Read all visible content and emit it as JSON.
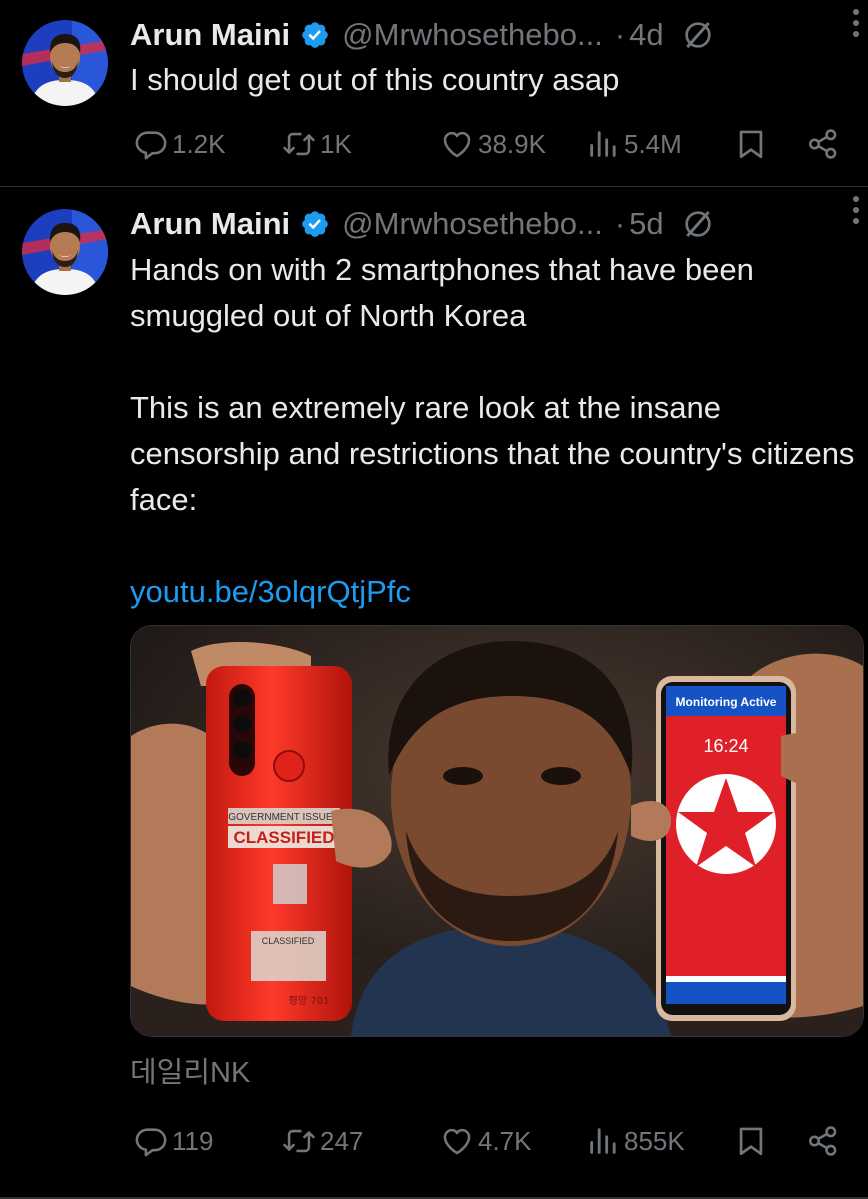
{
  "tweets": [
    {
      "author": "Arun Maini",
      "handle": "@Mrwhosethebo...",
      "separator": "·",
      "time": "4d",
      "paragraphs": [
        "I should get out of this country asap"
      ],
      "stats": {
        "replies": "1.2K",
        "retweets": "1K",
        "likes": "38.9K",
        "views": "5.4M"
      }
    },
    {
      "author": "Arun Maini",
      "handle": "@Mrwhosethebo...",
      "separator": "·",
      "time": "5d",
      "paragraphs": [
        "Hands on with 2 smartphones that have been smuggled out of North Korea",
        "This is an extremely rare look at the insane censorship and restrictions that the country's citizens face:"
      ],
      "link": "youtu.be/3olqrQtjPfc",
      "media": {
        "label_government": "GOVERNMENT ISSUED",
        "label_classified": "CLASSIFIED",
        "label_classified_small": "CLASSIFIED",
        "phone_model": "평양 701",
        "monitor_banner": "Monitoring Active",
        "clock": "16:24"
      },
      "source": "데일리NK",
      "stats": {
        "replies": "119",
        "retweets": "247",
        "likes": "4.7K",
        "views": "855K"
      }
    }
  ],
  "icons": {
    "verified": "verified-badge-icon",
    "grok": "grok-icon",
    "more": "more-icon",
    "reply": "reply-icon",
    "retweet": "retweet-icon",
    "like": "heart-icon",
    "views": "views-icon",
    "bookmark": "bookmark-icon",
    "share": "share-icon"
  },
  "colors": {
    "background": "#000000",
    "text": "#e7e9ea",
    "muted": "#71767b",
    "link": "#1d9bf0",
    "divider": "#2f3336"
  }
}
